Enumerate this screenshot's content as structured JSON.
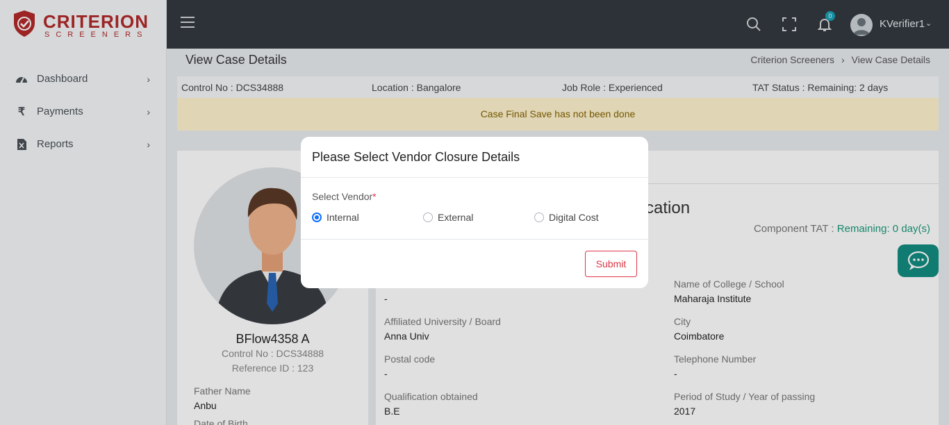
{
  "brand": {
    "name": "CRITERION",
    "tagline": "SCREENERS"
  },
  "sidebar": {
    "items": [
      {
        "label": "Dashboard",
        "icon": "tachometer-icon"
      },
      {
        "label": "Payments",
        "icon": "rupee-icon"
      },
      {
        "label": "Reports",
        "icon": "file-excel-icon"
      }
    ]
  },
  "topbar": {
    "notification_count": "0",
    "username": "KVerifier1"
  },
  "page": {
    "title": "View Case Details",
    "breadcrumb": [
      "Criterion Screeners",
      "View Case Details"
    ],
    "breadcrumb_sep": "›"
  },
  "info_bar": {
    "control_no": "Control No : DCS34888",
    "location": "Location : Bangalore",
    "job_role": "Job Role : Experienced",
    "tat_status": "TAT Status : Remaining: 2 days"
  },
  "alert": {
    "text": "Case Final Save has not been done"
  },
  "profile": {
    "name": "BFlow4358 A",
    "control_no": "Control No : DCS34888",
    "reference_id": "Reference ID : 123",
    "father_label": "Father Name",
    "father_value": "Anbu",
    "dob_label": "Date of Birth"
  },
  "section": {
    "title_fragment": "cation",
    "component_tat_label": "Component TAT :",
    "component_tat_value": "Remaining: 0 day(s)",
    "fields": {
      "first_value": "-",
      "college_label": "Name of College / School",
      "college_value": "Maharaja Institute",
      "university_label": "Affiliated University / Board",
      "university_value": "Anna Univ",
      "city_label": "City",
      "city_value": "Coimbatore",
      "postal_label": "Postal code",
      "postal_value": "-",
      "telephone_label": "Telephone Number",
      "telephone_value": "-",
      "qualification_label": "Qualification obtained",
      "qualification_value": "B.E",
      "period_label": "Period of Study / Year of passing",
      "period_value": "2017"
    }
  },
  "modal": {
    "title": "Please Select Vendor Closure Details",
    "vendor_label": "Select Vendor",
    "required_mark": "*",
    "options": [
      {
        "label": "Internal",
        "selected": true
      },
      {
        "label": "External",
        "selected": false
      },
      {
        "label": "Digital Cost",
        "selected": false
      }
    ],
    "submit_label": "Submit"
  },
  "colors": {
    "topbar": "#343a40",
    "brand_red": "#b22a2a",
    "accent_teal": "#138c80",
    "radio_blue": "#0d6efd",
    "danger": "#dc3545"
  }
}
